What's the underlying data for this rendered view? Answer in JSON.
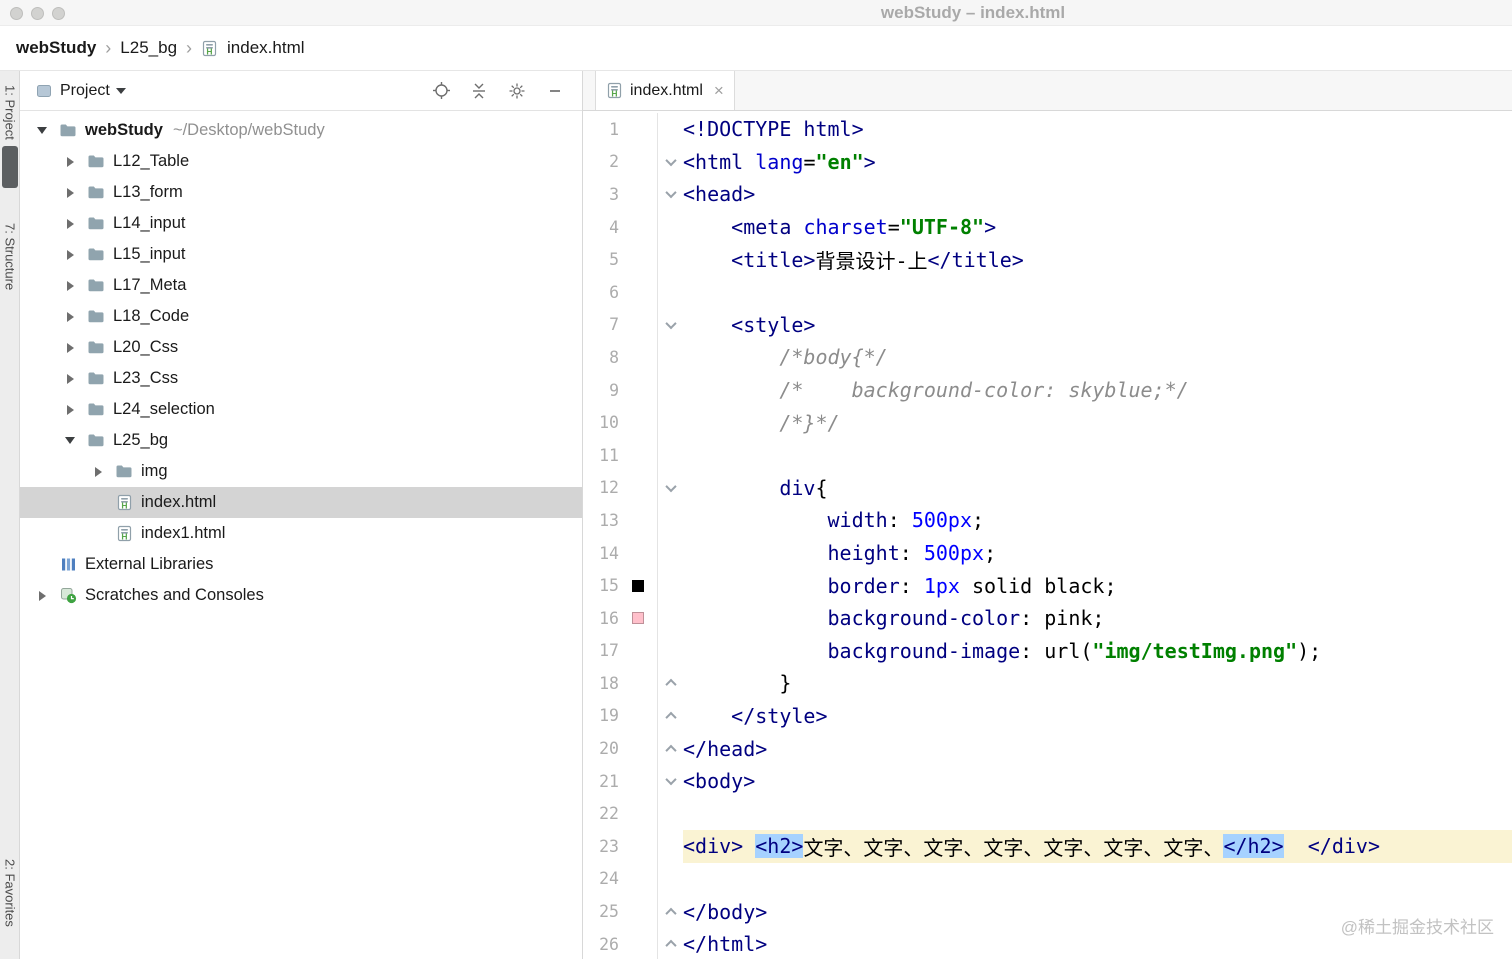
{
  "window": {
    "title": "webStudy – index.html",
    "controls": [
      "close",
      "minimize",
      "zoom"
    ]
  },
  "breadcrumb": {
    "items": [
      {
        "label": "webStudy",
        "bold": true,
        "icon": null
      },
      {
        "label": "L25_bg",
        "bold": false,
        "icon": null
      },
      {
        "label": "index.html",
        "bold": false,
        "icon": "html"
      }
    ],
    "separator": "›"
  },
  "tool_strip": {
    "top": "1: Project",
    "middle": "7: Structure",
    "bottom": "2: Favorites"
  },
  "project_panel": {
    "title": "Project",
    "header_icons": [
      "locate",
      "collapse-all",
      "settings",
      "hide"
    ],
    "tree": [
      {
        "level": 0,
        "arrow": "down",
        "icon": "folder",
        "label": "webStudy",
        "bold": true,
        "suffix": "~/Desktop/webStudy"
      },
      {
        "level": 1,
        "arrow": "right",
        "icon": "folder",
        "label": "L12_Table"
      },
      {
        "level": 1,
        "arrow": "right",
        "icon": "folder",
        "label": "L13_form"
      },
      {
        "level": 1,
        "arrow": "right",
        "icon": "folder",
        "label": "L14_input"
      },
      {
        "level": 1,
        "arrow": "right",
        "icon": "folder",
        "label": "L15_input"
      },
      {
        "level": 1,
        "arrow": "right",
        "icon": "folder",
        "label": "L17_Meta"
      },
      {
        "level": 1,
        "arrow": "right",
        "icon": "folder",
        "label": "L18_Code"
      },
      {
        "level": 1,
        "arrow": "right",
        "icon": "folder",
        "label": "L20_Css"
      },
      {
        "level": 1,
        "arrow": "right",
        "icon": "folder",
        "label": "L23_Css"
      },
      {
        "level": 1,
        "arrow": "right",
        "icon": "folder",
        "label": "L24_selection"
      },
      {
        "level": 1,
        "arrow": "down",
        "icon": "folder",
        "label": "L25_bg"
      },
      {
        "level": 2,
        "arrow": "right",
        "icon": "folder",
        "label": "img"
      },
      {
        "level": 2,
        "arrow": null,
        "icon": "html",
        "label": "index.html",
        "selected": true
      },
      {
        "level": 2,
        "arrow": null,
        "icon": "html",
        "label": "index1.html"
      },
      {
        "level": 0,
        "arrow": null,
        "icon": "libs",
        "label": "External Libraries"
      },
      {
        "level": 0,
        "arrow": "right",
        "icon": "scratch",
        "label": "Scratches and Consoles"
      }
    ]
  },
  "editor": {
    "tab": {
      "label": "index.html",
      "close": "×",
      "icon": "html"
    },
    "current_line": 23,
    "lines": [
      {
        "n": 1,
        "tokens": [
          [
            "t",
            "<!DOCTYPE html>"
          ]
        ]
      },
      {
        "n": 2,
        "fold": "down",
        "tokens": [
          [
            "t",
            "<html"
          ],
          [
            "x",
            " "
          ],
          [
            "a",
            "lang"
          ],
          [
            "x",
            "="
          ],
          [
            "s",
            "\"en\""
          ],
          [
            "t",
            ">"
          ]
        ]
      },
      {
        "n": 3,
        "fold": "down",
        "tokens": [
          [
            "t",
            "<head>"
          ]
        ]
      },
      {
        "n": 4,
        "tokens": [
          [
            "x",
            "    "
          ],
          [
            "t",
            "<meta"
          ],
          [
            "x",
            " "
          ],
          [
            "a",
            "charset"
          ],
          [
            "x",
            "="
          ],
          [
            "s",
            "\"UTF-8\""
          ],
          [
            "t",
            ">"
          ]
        ]
      },
      {
        "n": 5,
        "tokens": [
          [
            "x",
            "    "
          ],
          [
            "t",
            "<title>"
          ],
          [
            "x",
            "背景设计-上"
          ],
          [
            "t",
            "</title>"
          ]
        ]
      },
      {
        "n": 6,
        "tokens": []
      },
      {
        "n": 7,
        "fold": "down",
        "tokens": [
          [
            "x",
            "    "
          ],
          [
            "t",
            "<style>"
          ]
        ]
      },
      {
        "n": 8,
        "tokens": [
          [
            "x",
            "        "
          ],
          [
            "c",
            "/*body{*/"
          ]
        ]
      },
      {
        "n": 9,
        "tokens": [
          [
            "x",
            "        "
          ],
          [
            "c",
            "/*    background-color: skyblue;*/"
          ]
        ]
      },
      {
        "n": 10,
        "tokens": [
          [
            "x",
            "        "
          ],
          [
            "c",
            "/*}*/"
          ]
        ]
      },
      {
        "n": 11,
        "tokens": []
      },
      {
        "n": 12,
        "fold": "down",
        "tokens": [
          [
            "x",
            "        "
          ],
          [
            "t",
            "div"
          ],
          [
            "x",
            "{"
          ]
        ]
      },
      {
        "n": 13,
        "tokens": [
          [
            "x",
            "            "
          ],
          [
            "p",
            "width"
          ],
          [
            "x",
            ": "
          ],
          [
            "v",
            "500px"
          ],
          [
            "x",
            ";"
          ]
        ]
      },
      {
        "n": 14,
        "tokens": [
          [
            "x",
            "            "
          ],
          [
            "p",
            "height"
          ],
          [
            "x",
            ": "
          ],
          [
            "v",
            "500px"
          ],
          [
            "x",
            ";"
          ]
        ]
      },
      {
        "n": 15,
        "swatch": "#000000",
        "tokens": [
          [
            "x",
            "            "
          ],
          [
            "p",
            "border"
          ],
          [
            "x",
            ": "
          ],
          [
            "v",
            "1px"
          ],
          [
            "x",
            " solid black;"
          ]
        ]
      },
      {
        "n": 16,
        "swatch": "#FFC0CB",
        "tokens": [
          [
            "x",
            "            "
          ],
          [
            "p",
            "background-color"
          ],
          [
            "x",
            ": pink;"
          ]
        ]
      },
      {
        "n": 17,
        "tokens": [
          [
            "x",
            "            "
          ],
          [
            "p",
            "background-image"
          ],
          [
            "x",
            ": url("
          ],
          [
            "s",
            "\"img/testImg.png\""
          ],
          [
            "x",
            ");"
          ]
        ]
      },
      {
        "n": 18,
        "fold": "up",
        "tokens": [
          [
            "x",
            "        }"
          ]
        ]
      },
      {
        "n": 19,
        "fold": "up",
        "tokens": [
          [
            "x",
            "    "
          ],
          [
            "t",
            "</style>"
          ]
        ]
      },
      {
        "n": 20,
        "fold": "up",
        "tokens": [
          [
            "t",
            "</head>"
          ]
        ]
      },
      {
        "n": 21,
        "fold": "down",
        "tokens": [
          [
            "t",
            "<body>"
          ]
        ]
      },
      {
        "n": 22,
        "tokens": []
      },
      {
        "n": 23,
        "current": true,
        "tokens": [
          [
            "t",
            "<div>"
          ],
          [
            "x",
            " "
          ],
          [
            "T",
            "<h2>"
          ],
          [
            "x",
            "文字、文字、文字、文字、文字、文字、文字、"
          ],
          [
            "T",
            "</h2>"
          ],
          [
            "x",
            "  "
          ],
          [
            "t",
            "</div>"
          ]
        ]
      },
      {
        "n": 24,
        "tokens": []
      },
      {
        "n": 25,
        "fold": "up",
        "tokens": [
          [
            "t",
            "</body>"
          ]
        ]
      },
      {
        "n": 26,
        "fold": "up",
        "tokens": [
          [
            "t",
            "</html>"
          ]
        ]
      }
    ]
  },
  "watermark": "@稀土掘金技术社区"
}
